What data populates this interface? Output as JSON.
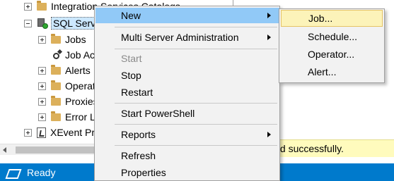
{
  "tree": {
    "items": [
      {
        "label": "Integration Services Catalogs",
        "expander": "plus",
        "icon": "folder-icon"
      },
      {
        "label": "SQL Server Agent",
        "expander": "minus",
        "icon": "sql-agent-icon",
        "selected": true
      },
      {
        "label": "Jobs",
        "expander": "plus",
        "icon": "folder-icon"
      },
      {
        "label": "Job Activity Monitor",
        "expander": "none",
        "icon": "job-activity-icon"
      },
      {
        "label": "Alerts",
        "expander": "plus",
        "icon": "folder-icon"
      },
      {
        "label": "Operators",
        "expander": "plus",
        "icon": "folder-icon"
      },
      {
        "label": "Proxies",
        "expander": "plus",
        "icon": "folder-icon"
      },
      {
        "label": "Error Logs",
        "expander": "plus",
        "icon": "folder-icon"
      },
      {
        "label": "XEvent Profiler",
        "expander": "plus",
        "icon": "xevent-icon"
      }
    ]
  },
  "context_menu": {
    "items": [
      {
        "label": "New",
        "submenu": true,
        "highlighted": true
      },
      {
        "label": "Multi Server Administration",
        "submenu": true
      },
      {
        "label": "Start",
        "disabled": true
      },
      {
        "label": "Stop"
      },
      {
        "label": "Restart"
      },
      {
        "label": "Start PowerShell"
      },
      {
        "label": "Reports",
        "submenu": true
      },
      {
        "label": "Refresh"
      },
      {
        "label": "Properties"
      }
    ]
  },
  "submenu": {
    "items": [
      {
        "label": "Job...",
        "highlighted": true
      },
      {
        "label": "Schedule..."
      },
      {
        "label": "Operator..."
      },
      {
        "label": "Alert..."
      }
    ]
  },
  "message_bar": {
    "text": "y executed successfully.",
    "color": "#fffbbd"
  },
  "status_bar": {
    "text": "Ready",
    "color": "#007acc"
  }
}
